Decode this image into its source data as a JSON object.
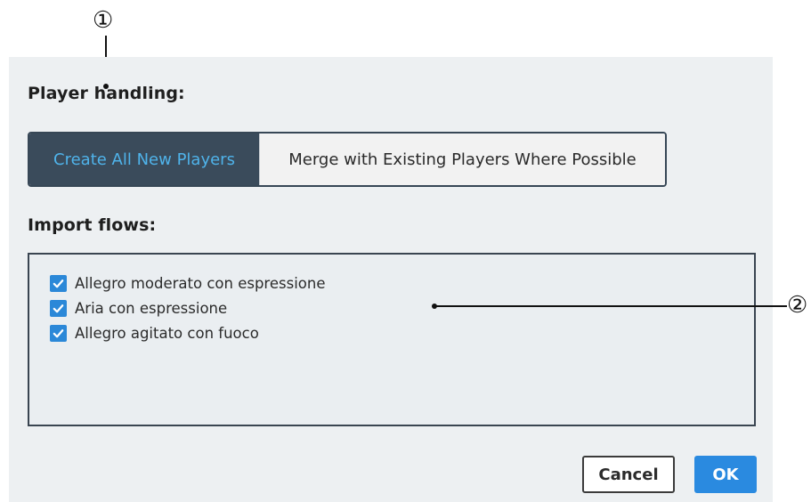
{
  "dialog": {
    "player_handling_label": "Player handling:",
    "segmented": {
      "options": [
        {
          "label": "Create All New Players",
          "selected": true
        },
        {
          "label": "Merge with Existing Players Where Possible",
          "selected": false
        }
      ]
    },
    "import_flows_label": "Import flows:",
    "flows": [
      {
        "label": "Allegro moderato con espressione",
        "checked": true
      },
      {
        "label": "Aria con espressione",
        "checked": true
      },
      {
        "label": "Allegro agitato con fuoco",
        "checked": true
      }
    ],
    "buttons": {
      "cancel": "Cancel",
      "ok": "OK"
    }
  },
  "callouts": {
    "one": "①",
    "two": "②"
  },
  "colors": {
    "dialog_bg": "#edf0f2",
    "segment_active_bg": "#3a4b5b",
    "segment_active_text": "#4fb3ea",
    "checkbox_fill": "#2b88d8",
    "ok_button": "#2a8ae0"
  },
  "icons": {
    "checkbox": "check-icon"
  }
}
